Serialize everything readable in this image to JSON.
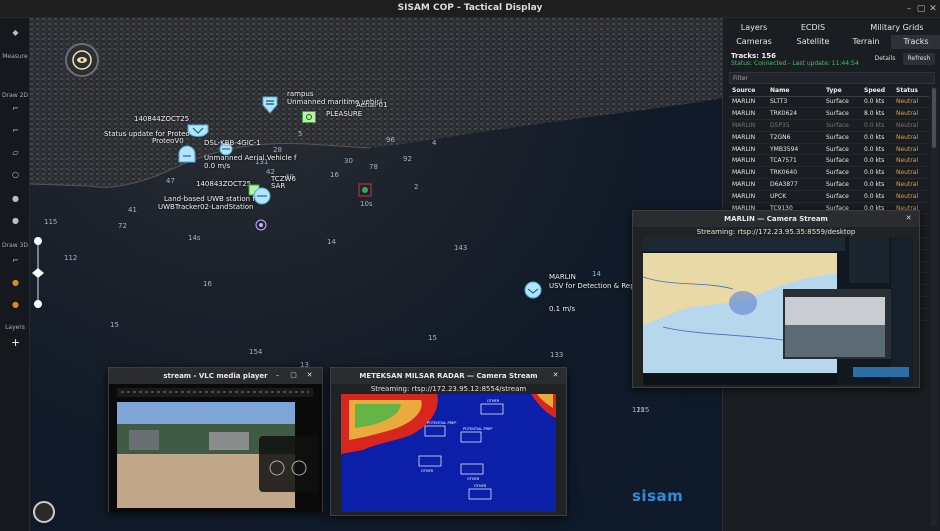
{
  "window": {
    "title": "SISAM COP - Tactical Display"
  },
  "toolbar": {
    "measure": "Measure",
    "draw2d": "Draw 2D",
    "draw3d": "Draw 3D",
    "layers": "Layers"
  },
  "panel": {
    "tabs_row1": [
      "Layers",
      "ECDIS",
      "Military Grids"
    ],
    "tabs_row2": [
      "Cameras",
      "Satellite",
      "Terrain",
      "Tracks"
    ],
    "active_tab": "Tracks",
    "track_count": "Tracks: 156",
    "status": "Status: Connected - Last update: 11:44:54",
    "details_btn": "Details",
    "refresh_btn": "Refresh",
    "filter_placeholder": "Filter",
    "columns": [
      "Source",
      "Name",
      "Type",
      "Speed",
      "Status"
    ],
    "rows": [
      [
        "MARLIN",
        "SLTT3",
        "Surface",
        "0.0 kts",
        "Neutral"
      ],
      [
        "MARLIN",
        "TRK0624",
        "Surface",
        "8.0 kts",
        "Neutral"
      ],
      [
        "MARLIN",
        "D5P35",
        "Surface",
        "0.0 kts",
        "Neutral"
      ],
      [
        "MARLIN",
        "T2GN6",
        "Surface",
        "0.0 kts",
        "Neutral"
      ],
      [
        "MARLIN",
        "YMB3594",
        "Surface",
        "0.0 kts",
        "Neutral"
      ],
      [
        "MARLIN",
        "TCA7571",
        "Surface",
        "0.0 kts",
        "Neutral"
      ],
      [
        "MARLIN",
        "TRK0640",
        "Surface",
        "0.0 kts",
        "Neutral"
      ],
      [
        "MARLIN",
        "D6A3877",
        "Surface",
        "0.0 kts",
        "Neutral"
      ],
      [
        "MARLIN",
        "UPCK",
        "Surface",
        "0.0 kts",
        "Neutral"
      ],
      [
        "MARLIN",
        "TC9130",
        "Surface",
        "0.0 kts",
        "Neutral"
      ],
      [
        "MARLIN",
        "TRK0669",
        "Surface",
        "6.3 kts",
        "Neutral"
      ],
      [
        "MARLIN",
        "TRK0573",
        "Surface",
        "0.0 kts",
        "Neutral"
      ],
      [
        "MARLIN",
        "TRK0583",
        "Surface",
        "0.0 kts",
        "Neutral"
      ],
      [
        "MARLIN",
        "3FCK9",
        "Surface",
        "0.0 kts",
        "Neutral"
      ],
      [
        "MARLIN",
        "HPUW",
        "Surface",
        "0.0 kts",
        "Neutral"
      ],
      [
        "MARLIN",
        "TRK0606",
        "Surface",
        "0.0 kts",
        "Neutral"
      ],
      [
        "MARLIN",
        "ZGRM4",
        "Surface",
        "0.0 kts",
        "Neutral"
      ],
      [
        "MARLIN",
        "TRK0572",
        "Surface",
        "0.0 kts",
        "Neutral"
      ],
      [
        "MARLIN",
        "TCA8513",
        "Surface",
        "0.0 kts",
        "Neutral"
      ]
    ]
  },
  "map": {
    "labels": {
      "rampus": "rampus",
      "rampus_desc": "Unmanned maritime vehicl",
      "aerial": "Aerial-01",
      "pleasure": "PLEASURE",
      "trk1_id": "140844ZOCT25",
      "trk1_desc": "Status update for Proteo",
      "trk1_desc2": "ProteoV0",
      "dsl": "DSL-KBB-4GIC-1",
      "uav": "Unmanned Aerial Vehicle f",
      "uav_speed": "0.0 m/s",
      "trk2_id": "140843ZOCT25",
      "tczw6": "TCZW6",
      "sar": "SAR",
      "land_based": "Land-based UWB station f",
      "uwb": "UWBTracker02-LandStation",
      "marlin": "MARLIN",
      "marlin_desc": "USV for Detection & Repo",
      "marlin_speed": "0.1 m/s"
    },
    "depths": [
      "115",
      "72",
      "47",
      "41",
      "112",
      "14s",
      "16",
      "15",
      "16",
      "10s",
      "14",
      "143",
      "15",
      "13",
      "154",
      "133",
      "14",
      "12s",
      "5",
      "96",
      "131",
      "28",
      "40",
      "42",
      "78",
      "92",
      "4",
      "30",
      "2",
      "125",
      "14"
    ],
    "brand": "sisam"
  },
  "vlc": {
    "title": "stream - VLC media player"
  },
  "radar": {
    "title": "METEKSAN MILSAR RADAR — Camera Stream",
    "url": "Streaming: rtsp://172.23.95.12:8554/stream",
    "targets": [
      "POTENTIAL PREP",
      "POTENTIAL PREP",
      "OTHER",
      "OTHER",
      "OTHER",
      "OTHER"
    ]
  },
  "marlin_cam": {
    "title": "MARLIN — Camera Stream",
    "url": "Streaming: rtsp://172.23.95.35:8559/desktop"
  }
}
